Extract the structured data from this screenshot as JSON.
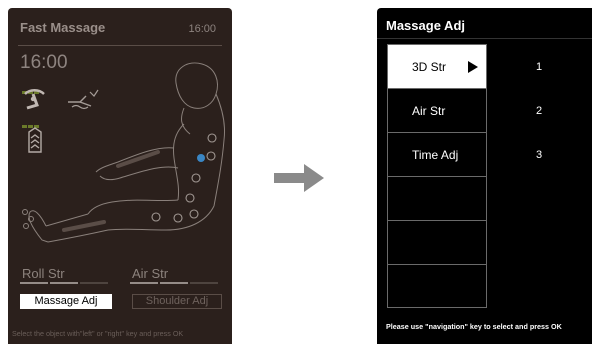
{
  "left_screen": {
    "title": "Fast Massage",
    "time_top": "16:00",
    "clock": "16:00",
    "roll_label": "Roll Str",
    "air_label": "Air Str",
    "roll_strength_level": 2,
    "air_strength_level": 2,
    "massage_adj_button": "Massage Adj",
    "shoulder_adj_button": "Shoulder Adj",
    "hint": "Select the object with\"left\" or \"right\" key and press OK"
  },
  "right_screen": {
    "title": "Massage Adj",
    "items": [
      {
        "label": "3D Str",
        "value": "1",
        "selected": true
      },
      {
        "label": "Air Str",
        "value": "2",
        "selected": false
      },
      {
        "label": "Time Adj",
        "value": "3",
        "selected": false
      },
      {
        "label": "",
        "value": "",
        "selected": false
      },
      {
        "label": "",
        "value": "",
        "selected": false
      },
      {
        "label": "",
        "value": "",
        "selected": false
      }
    ],
    "hint": "Please use \"navigation\" key to select and press OK"
  },
  "colors": {
    "left_bg": "#2b201c",
    "right_bg": "#000000",
    "highlight": "#ffffff",
    "sensor_dot": "#3a86c4",
    "arrow": "#8a8a8a"
  },
  "icons": {
    "massage_mode": "recliner-roller-icon",
    "heat_mode": "leg-wave-icon",
    "backrest": "back-roller-icon",
    "foot": "foot-roller-icon"
  }
}
